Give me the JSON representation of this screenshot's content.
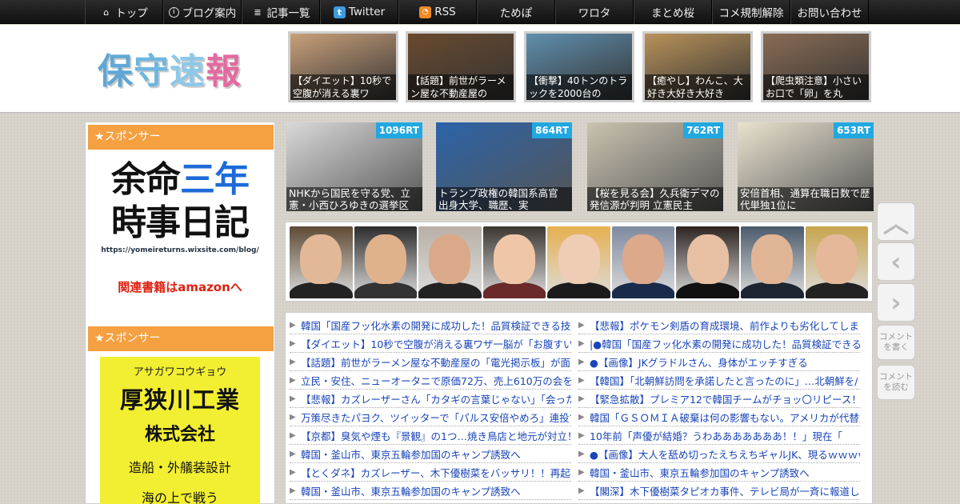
{
  "nav": [
    {
      "icon": "home-icon",
      "glyph": "⌂",
      "label": "トップ"
    },
    {
      "icon": "info-icon",
      "glyph": "i",
      "label": "ブログ案内"
    },
    {
      "icon": "list-icon",
      "glyph": "≣",
      "label": "記事一覧"
    },
    {
      "icon": "twitter-icon",
      "glyph": "t",
      "label": "Twitter"
    },
    {
      "icon": "rss-icon",
      "glyph": "◔",
      "label": "RSS"
    },
    {
      "label": "ためぽ"
    },
    {
      "label": "ワロタ"
    },
    {
      "label": "まとめ桜"
    },
    {
      "label": "コメ規制解除"
    },
    {
      "label": "お問い合わせ"
    }
  ],
  "site_logo": "保守速報",
  "header_thumbs": [
    {
      "caption": "【ダイエット】10秒で空腹が消える裏ワ",
      "color": "#c9a07a"
    },
    {
      "caption": "【話題】前世がラーメン屋な不動産屋の",
      "color": "#6a4a2e"
    },
    {
      "caption": "【衝撃】40トンのトラックを2000台の",
      "color": "#5f8fae"
    },
    {
      "caption": "【癒やし】わんこ、大好き大好き大好き",
      "color": "#b9925a"
    },
    {
      "caption": "【爬虫類注意】小さいお口で「卵」を丸",
      "color": "#8a6c55"
    }
  ],
  "sidebar": {
    "sponsor1_label": "★スポンサー",
    "ad1": {
      "line1_a": "余命",
      "line1_b": "三年",
      "line2": "時事日記",
      "url": "https://yomeireturns.wixsite.com/blog/",
      "amazon": "関連書籍はamazonへ"
    },
    "sponsor2_label": "★スポンサー",
    "ad2": {
      "kana": "アサガワコウギョウ",
      "name": "厚狭川工業",
      "corp": "株式会社",
      "biz": "造船・外艤装設計",
      "more": "海の上で戦う"
    }
  },
  "rt_thumbs": [
    {
      "rt": "1096RT",
      "caption": "NHKから国民を守る党、立憲・小西ひろゆきの選挙区",
      "color": "#d9d9d9"
    },
    {
      "rt": "864RT",
      "caption": "トランプ政権の韓国系高官 出身大学、職歴、実",
      "color": "#2b63a8"
    },
    {
      "rt": "762RT",
      "caption": "【桜を見る会】久兵衛デマの発信源が判明 立憲民主",
      "color": "#c9c2b0"
    },
    {
      "rt": "653RT",
      "caption": "安倍首相、通算在職日数で歴代単独1位に",
      "color": "#e9e2cf"
    }
  ],
  "side_buttons": {
    "up": "︿",
    "back": "‹",
    "forward": "›",
    "write_comment": "コメントを書く",
    "read_comment": "コメントを読む"
  },
  "banner_faces": [
    {
      "skin": "#e3b896",
      "bg": "#5e4a35",
      "body": "#222"
    },
    {
      "skin": "#e0b28c",
      "bg": "#2c2c2c",
      "body": "#333"
    },
    {
      "skin": "#d9a98a",
      "bg": "#b9b0a6",
      "body": "#222"
    },
    {
      "skin": "#efc7a8",
      "bg": "#3a3530",
      "body": "#6a2a2a"
    },
    {
      "skin": "#efcdb5",
      "bg": "#e6b050",
      "body": "#1b1b1b"
    },
    {
      "skin": "#dca98b",
      "bg": "#7f8aa0",
      "body": "#1a2a4a"
    },
    {
      "skin": "#e8c0a3",
      "bg": "#2d2420",
      "body": "#111"
    },
    {
      "skin": "#e0b596",
      "bg": "#4b5a6c",
      "body": "#1b2430"
    },
    {
      "skin": "#e4b898",
      "bg": "#c8a54e",
      "body": "#222"
    }
  ],
  "links_left": [
    "韓国「国産フッ化水素の開発に成功した！品質検証できる技術",
    "【ダイエット】10秒で空腹が消える裏ワザ一脳が「お腹すいて",
    "【話題】前世がラーメン屋な不動産屋の「電光掲示板」が面白",
    "立民・安住、ニューオータニで原価72万、売上610万の会を開い",
    "【悲報】カズレーザーさん「カタギの言葉じゃない」「会った",
    "万策尽きたパヨク、ツイッターで「パルス安倍やめろ」連投で",
    "【京都】臭気や煙も『景観』の1つ…焼き鳥店と地元が対立！",
    "韓国・釜山市、東京五輪参加国のキャンプ誘致へ",
    "【とくダネ】カズレーザー、木下優樹菜をバッサリ！！再起不",
    "韓国・釜山市、東京五輪参加国のキャンプ誘致へ"
  ],
  "links_right": [
    "【悲報】ポケモン剣盾の育成環境、前作よりも劣化してしまう",
    "|●韓国「国産フッ化水素の開発に成功した！品質検証できる技",
    "●【画像】JKグラドルさん、身体がエッチすぎる",
    "【韓国】「北朝鮮訪問を承諾したと言ったのに」…北朝鮮を/",
    "【緊急拡散】プレミア12で韓国チームがチョッ〇リピース！←",
    "韓国「ＧＳＯＭＩＡ破棄は何の影響もない。アメリカが代替策",
    "10年前「声優が結婚？うわあああああああ！！」現在「",
    "●【画像】大人を舐め切ったえちえちギャルJK、現るｗｗｗｗ",
    "韓国・釜山市、東京五輪参加国のキャンプ誘致へ",
    "【閣深】木下優樹菜タピオカ事件、テレビ局が一斉に報道し始"
  ]
}
